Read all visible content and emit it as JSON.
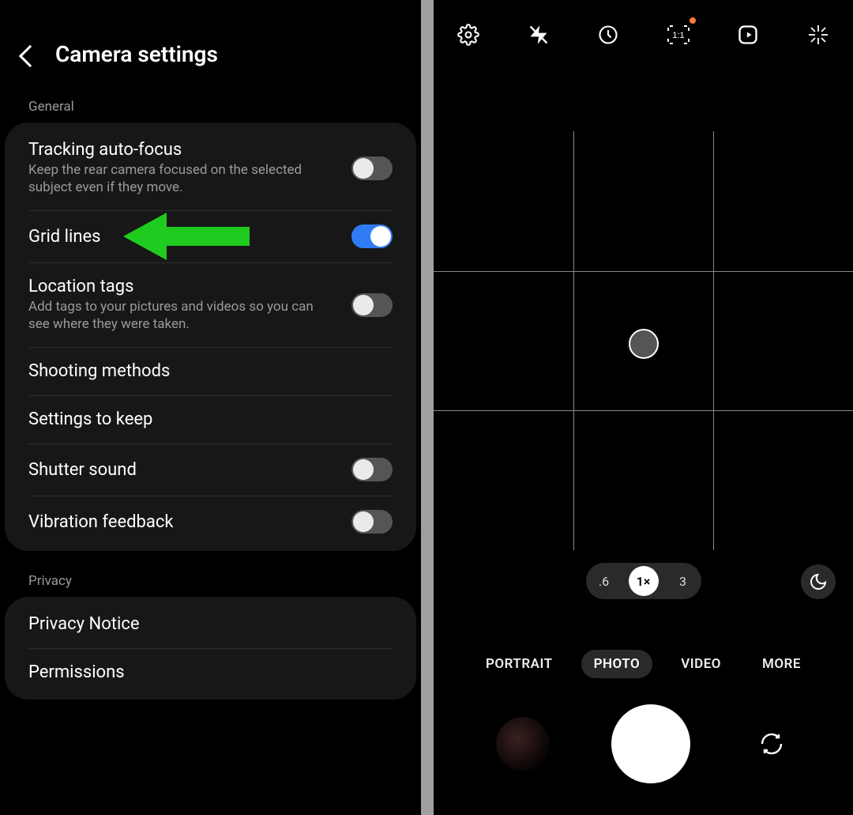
{
  "settings": {
    "title": "Camera settings",
    "sections": {
      "general": {
        "label": "General",
        "items": [
          {
            "title": "Tracking auto-focus",
            "desc": "Keep the rear camera focused on the selected subject even if they move.",
            "enabled": false
          },
          {
            "title": "Grid lines",
            "desc": null,
            "enabled": true
          },
          {
            "title": "Location tags",
            "desc": "Add tags to your pictures and videos so you can see where they were taken.",
            "enabled": false
          },
          {
            "title": "Shooting methods",
            "desc": null,
            "enabled": null
          },
          {
            "title": "Settings to keep",
            "desc": null,
            "enabled": null
          },
          {
            "title": "Shutter sound",
            "desc": null,
            "enabled": false
          },
          {
            "title": "Vibration feedback",
            "desc": null,
            "enabled": false
          }
        ]
      },
      "privacy": {
        "label": "Privacy",
        "items": [
          {
            "title": "Privacy Notice"
          },
          {
            "title": "Permissions"
          }
        ]
      }
    }
  },
  "camera": {
    "zoom": {
      "options": [
        ".6",
        "1×",
        "3"
      ],
      "active": "1×"
    },
    "modes": {
      "options": [
        "PORTRAIT",
        "PHOTO",
        "VIDEO",
        "MORE"
      ],
      "active": "PHOTO"
    }
  }
}
